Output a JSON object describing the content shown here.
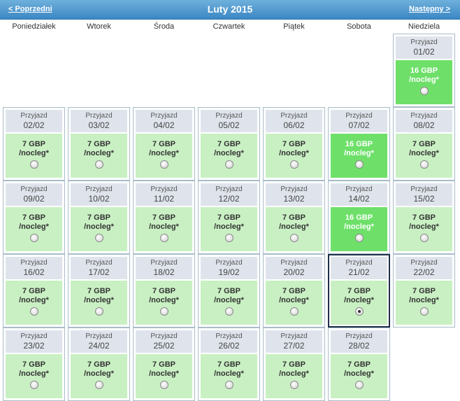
{
  "header": {
    "prev_label": "< Poprzedni",
    "title": "Luty 2015",
    "next_label": "Następny >"
  },
  "weekdays": [
    "Poniedziałek",
    "Wtorek",
    "Środa",
    "Czwartek",
    "Piątek",
    "Sobota",
    "Niedziela"
  ],
  "arrival_label": "Przyjazd",
  "unit_label": "/nocleg*",
  "colors": {
    "header": "#3b87c4",
    "cell_top": "#dfe4ec",
    "price_normal": "#c9f0c3",
    "price_highlight": "#6ee06a",
    "selected_border": "#1e2f4a"
  },
  "days": [
    {
      "date": "01/02",
      "price": "16 GBP",
      "highlight": true,
      "selected": false
    },
    {
      "date": "02/02",
      "price": "7 GBP",
      "highlight": false,
      "selected": false
    },
    {
      "date": "03/02",
      "price": "7 GBP",
      "highlight": false,
      "selected": false
    },
    {
      "date": "04/02",
      "price": "7 GBP",
      "highlight": false,
      "selected": false
    },
    {
      "date": "05/02",
      "price": "7 GBP",
      "highlight": false,
      "selected": false
    },
    {
      "date": "06/02",
      "price": "7 GBP",
      "highlight": false,
      "selected": false
    },
    {
      "date": "07/02",
      "price": "16 GBP",
      "highlight": true,
      "selected": false
    },
    {
      "date": "08/02",
      "price": "7 GBP",
      "highlight": false,
      "selected": false
    },
    {
      "date": "09/02",
      "price": "7 GBP",
      "highlight": false,
      "selected": false
    },
    {
      "date": "10/02",
      "price": "7 GBP",
      "highlight": false,
      "selected": false
    },
    {
      "date": "11/02",
      "price": "7 GBP",
      "highlight": false,
      "selected": false
    },
    {
      "date": "12/02",
      "price": "7 GBP",
      "highlight": false,
      "selected": false
    },
    {
      "date": "13/02",
      "price": "7 GBP",
      "highlight": false,
      "selected": false
    },
    {
      "date": "14/02",
      "price": "16 GBP",
      "highlight": true,
      "selected": false
    },
    {
      "date": "15/02",
      "price": "7 GBP",
      "highlight": false,
      "selected": false
    },
    {
      "date": "16/02",
      "price": "7 GBP",
      "highlight": false,
      "selected": false
    },
    {
      "date": "17/02",
      "price": "7 GBP",
      "highlight": false,
      "selected": false
    },
    {
      "date": "18/02",
      "price": "7 GBP",
      "highlight": false,
      "selected": false
    },
    {
      "date": "19/02",
      "price": "7 GBP",
      "highlight": false,
      "selected": false
    },
    {
      "date": "20/02",
      "price": "7 GBP",
      "highlight": false,
      "selected": false
    },
    {
      "date": "21/02",
      "price": "7 GBP",
      "highlight": false,
      "selected": true
    },
    {
      "date": "22/02",
      "price": "7 GBP",
      "highlight": false,
      "selected": false
    },
    {
      "date": "23/02",
      "price": "7 GBP",
      "highlight": false,
      "selected": false
    },
    {
      "date": "24/02",
      "price": "7 GBP",
      "highlight": false,
      "selected": false
    },
    {
      "date": "25/02",
      "price": "7 GBP",
      "highlight": false,
      "selected": false
    },
    {
      "date": "26/02",
      "price": "7 GBP",
      "highlight": false,
      "selected": false
    },
    {
      "date": "27/02",
      "price": "7 GBP",
      "highlight": false,
      "selected": false
    },
    {
      "date": "28/02",
      "price": "7 GBP",
      "highlight": false,
      "selected": false
    }
  ]
}
